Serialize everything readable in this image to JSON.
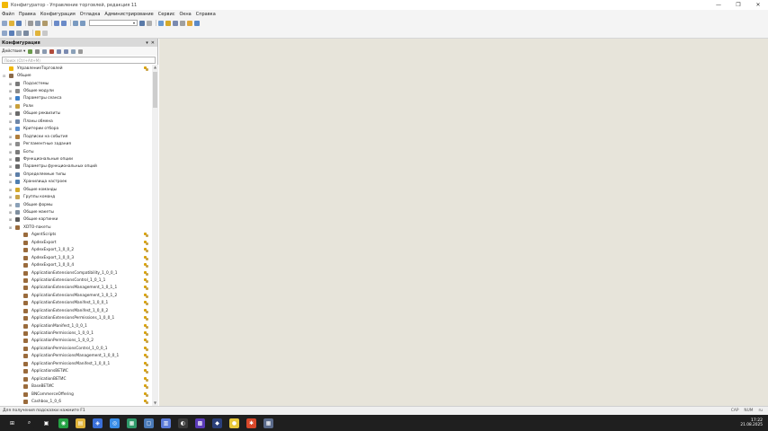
{
  "window": {
    "title": "Конфигуратор - Управление торговлей, редакция 11",
    "controls": [
      "—",
      "❐",
      "✕"
    ]
  },
  "menu": [
    "Файл",
    "Правка",
    "Конфигурация",
    "Отладка",
    "Администрирование",
    "Сервис",
    "Окна",
    "Справка"
  ],
  "colors": {
    "workspace": "#e7e4da",
    "taskbar": "#1f1f1f",
    "panel_header": "#d9d9d9",
    "accent": "#f2b807"
  },
  "panel": {
    "title": "Конфигурация",
    "actions_label": "Действия ▾",
    "search_placeholder": "Поиск (Ctrl+Alt+M)",
    "header_controls": [
      "▾",
      "✕"
    ]
  },
  "tree": {
    "root": "УправлениеТорговлей",
    "common": "Общие",
    "common_items": [
      {
        "label": "Подсистемы",
        "icon": "subsystems-icon",
        "color": "#7a7a7a"
      },
      {
        "label": "Общие модули",
        "icon": "module-icon",
        "color": "#8a8a8a"
      },
      {
        "label": "Параметры сеанса",
        "icon": "session-params-icon",
        "color": "#3c7fc9"
      },
      {
        "label": "Роли",
        "icon": "role-icon",
        "color": "#c9a03c"
      },
      {
        "label": "Общие реквизиты",
        "icon": "attribute-icon",
        "color": "#6b6b6b"
      },
      {
        "label": "Планы обмена",
        "icon": "exchange-plan-icon",
        "color": "#6e86a8"
      },
      {
        "label": "Критерии отбора",
        "icon": "filter-icon",
        "color": "#5a8fcf"
      },
      {
        "label": "Подписки на события",
        "icon": "event-subscription-icon",
        "color": "#b07e3c"
      },
      {
        "label": "Регламентные задания",
        "icon": "scheduled-job-icon",
        "color": "#8c8c8c"
      },
      {
        "label": "Боты",
        "icon": "bot-icon",
        "color": "#7c7c7c"
      },
      {
        "label": "Функциональные опции",
        "icon": "functional-option-icon",
        "color": "#6a6a6a"
      },
      {
        "label": "Параметры функциональных опций",
        "icon": "functional-option-params-icon",
        "color": "#6a6a6a"
      },
      {
        "label": "Определяемые типы",
        "icon": "defined-type-icon",
        "color": "#5c7ea8"
      },
      {
        "label": "Хранилища настроек",
        "icon": "settings-storage-icon",
        "color": "#4f7fb0"
      },
      {
        "label": "Общие команды",
        "icon": "command-icon",
        "color": "#d4a92a"
      },
      {
        "label": "Группы команд",
        "icon": "command-group-icon",
        "color": "#c9a44a"
      },
      {
        "label": "Общие формы",
        "icon": "form-icon",
        "color": "#8aa0b8"
      },
      {
        "label": "Общие макеты",
        "icon": "template-icon",
        "color": "#7f8f9f"
      },
      {
        "label": "Общие картинки",
        "icon": "picture-icon",
        "color": "#5b5b5b"
      },
      {
        "label": "XDTO-пакеты",
        "icon": "xdto-package-icon",
        "color": "#9a6b3c"
      }
    ],
    "xdto_items": [
      "AgentScripts",
      "ApdexExport",
      "ApdexExport_1_0_0_2",
      "ApdexExport_1_0_0_3",
      "ApdexExport_1_0_0_4",
      "ApplicationExtensionsCompatibility_1_0_0_1",
      "ApplicationExtensionsControl_1_0_1_1",
      "ApplicationExtensionsManagement_1_0_1_1",
      "ApplicationExtensionsManagement_1_0_1_2",
      "ApplicationExtensionsManifest_1_0_0_1",
      "ApplicationExtensionsManifest_1_0_0_2",
      "ApplicationExtensionsPermissions_1_0_0_1",
      "ApplicationManifest_1_0_0_1",
      "ApplicationPermissions_1_0_0_1",
      "ApplicationPermissions_1_0_0_2",
      "ApplicationPermissionsControl_1_0_0_1",
      "ApplicationPermissionsManagement_1_0_0_1",
      "ApplicationPermissionsManifest_1_0_0_1",
      "ApplicationsВЕТИС",
      "ApplicationВЕТИС",
      "BaseВЕТИС",
      "BNCommerceOffering",
      "Cashbox_1_0_6"
    ]
  },
  "statusbar": {
    "hint": "Для получения подсказки нажмите F1",
    "indicators": [
      "CAP",
      "NUM",
      "ru"
    ]
  },
  "taskbar": {
    "time": "17:22",
    "date": "21.08.2025",
    "apps": [
      {
        "name": "windows-start-icon",
        "glyph": "⊞",
        "color": "#1f1f1f"
      },
      {
        "name": "search-icon",
        "glyph": "⌕",
        "color": "#1f1f1f"
      },
      {
        "name": "task-view-icon",
        "glyph": "▣",
        "color": "#1f1f1f"
      },
      {
        "name": "whatsapp-icon",
        "glyph": "◉",
        "color": "#25a244"
      },
      {
        "name": "file-explorer-icon",
        "glyph": "▤",
        "color": "#e0b33a"
      },
      {
        "name": "app-blue-icon",
        "glyph": "◈",
        "color": "#3a6fd8"
      },
      {
        "name": "chrome-icon",
        "glyph": "◎",
        "color": "#3a8ee8"
      },
      {
        "name": "app-green-icon",
        "glyph": "▦",
        "color": "#2f9a6a"
      },
      {
        "name": "app-window-icon",
        "glyph": "▢",
        "color": "#4a7ab8"
      },
      {
        "name": "save-icon",
        "glyph": "▥",
        "color": "#5a7ad8"
      },
      {
        "name": "app-dark-icon",
        "glyph": "◐",
        "color": "#3a3a3a"
      },
      {
        "name": "app-purple-icon",
        "glyph": "▩",
        "color": "#5a3ab8"
      },
      {
        "name": "app-navy-icon",
        "glyph": "◆",
        "color": "#2b3f7a"
      },
      {
        "name": "app-yellow-icon",
        "glyph": "●",
        "color": "#e8c83a"
      },
      {
        "name": "app-red-icon",
        "glyph": "✱",
        "color": "#d8482a"
      },
      {
        "name": "calculator-icon",
        "glyph": "▦",
        "color": "#5a6a8a"
      }
    ]
  }
}
